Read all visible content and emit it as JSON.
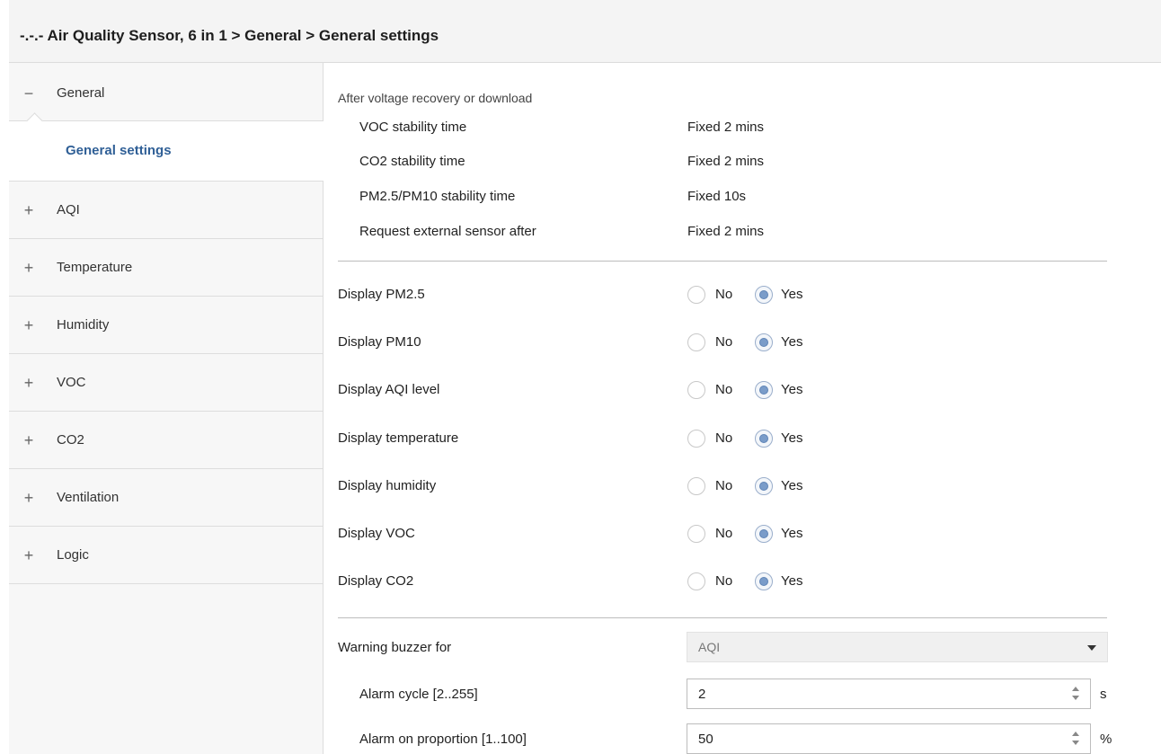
{
  "header": {
    "title": "-.-.- Air Quality Sensor, 6 in 1 > General > General settings"
  },
  "sidebar": {
    "items": [
      {
        "label": "General",
        "sign": "−"
      },
      {
        "label": "General settings"
      },
      {
        "label": "AQI",
        "sign": "+"
      },
      {
        "label": "Temperature",
        "sign": "+"
      },
      {
        "label": "Humidity",
        "sign": "+"
      },
      {
        "label": "VOC",
        "sign": "+"
      },
      {
        "label": "CO2",
        "sign": "+"
      },
      {
        "label": "Ventilation",
        "sign": "+"
      },
      {
        "label": "Logic",
        "sign": "+"
      }
    ]
  },
  "main": {
    "section_heading": "After voltage recovery or download",
    "info_rows": [
      {
        "label": "VOC stability time",
        "value": "Fixed 2 mins"
      },
      {
        "label": "CO2 stability time",
        "value": "Fixed 2 mins"
      },
      {
        "label": "PM2.5/PM10 stability time",
        "value": "Fixed 10s"
      },
      {
        "label": "Request external sensor after",
        "value": "Fixed 2 mins"
      }
    ],
    "radio_options": {
      "no": "No",
      "yes": "Yes"
    },
    "display_rows": [
      {
        "label": "Display PM2.5",
        "selected": "Yes"
      },
      {
        "label": "Display PM10",
        "selected": "Yes"
      },
      {
        "label": "Display AQI level",
        "selected": "Yes"
      },
      {
        "label": "Display temperature",
        "selected": "Yes"
      },
      {
        "label": "Display humidity",
        "selected": "Yes"
      },
      {
        "label": "Display VOC",
        "selected": "Yes"
      },
      {
        "label": "Display CO2",
        "selected": "Yes"
      }
    ],
    "warning_buzzer": {
      "label": "Warning buzzer for",
      "value": "AQI"
    },
    "alarm_cycle": {
      "label": "Alarm cycle [2..255]",
      "value": "2",
      "unit": "s"
    },
    "alarm_on_proportion": {
      "label": "Alarm on proportion [1..100]",
      "value": "50",
      "unit": "%"
    }
  }
}
